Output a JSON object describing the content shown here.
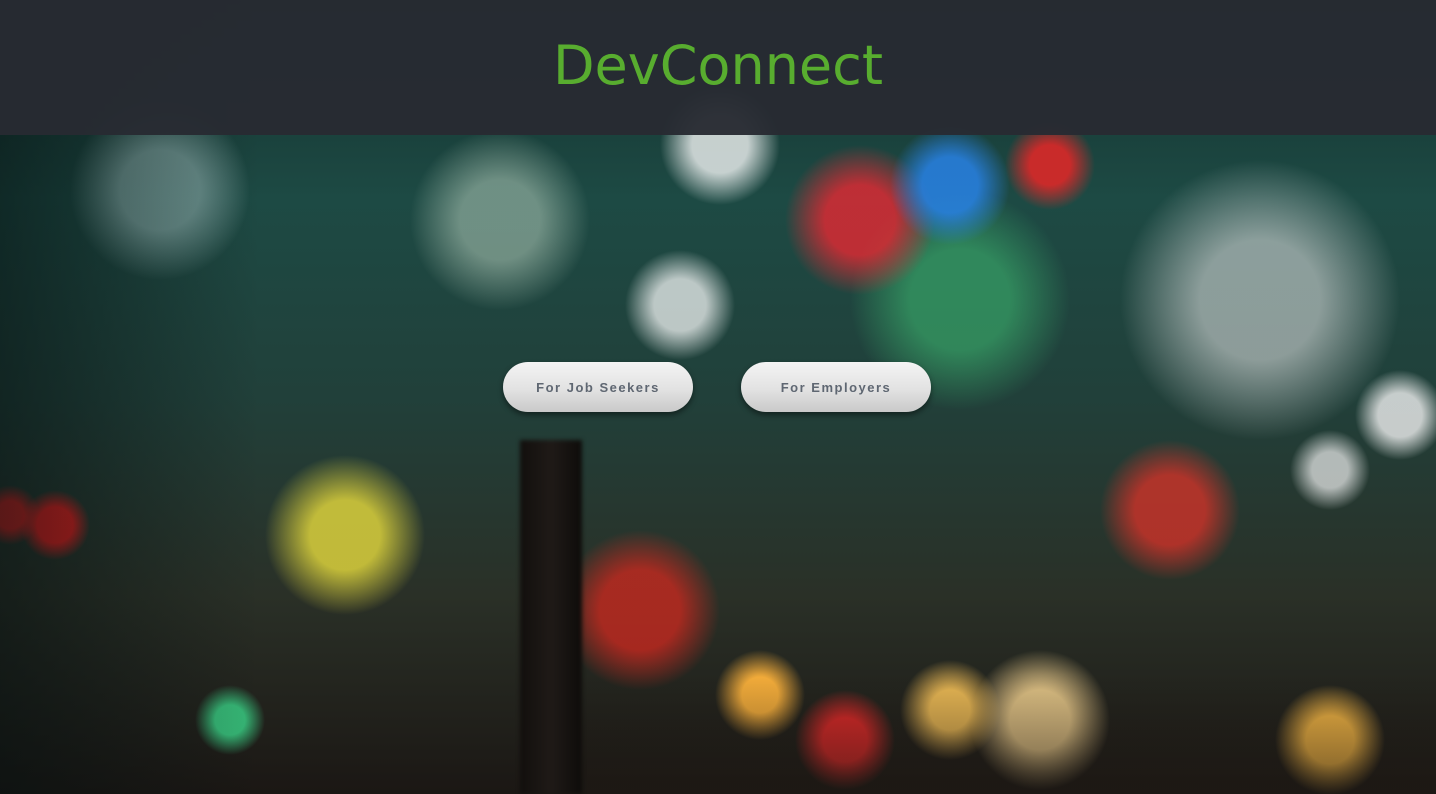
{
  "header": {
    "brand": "DevConnect",
    "brand_color": "#58ad2f"
  },
  "actions": {
    "job_seekers_label": "For Job Seekers",
    "employers_label": "For Employers"
  },
  "background": {
    "description_icon": "blurred-city-night-photo"
  }
}
